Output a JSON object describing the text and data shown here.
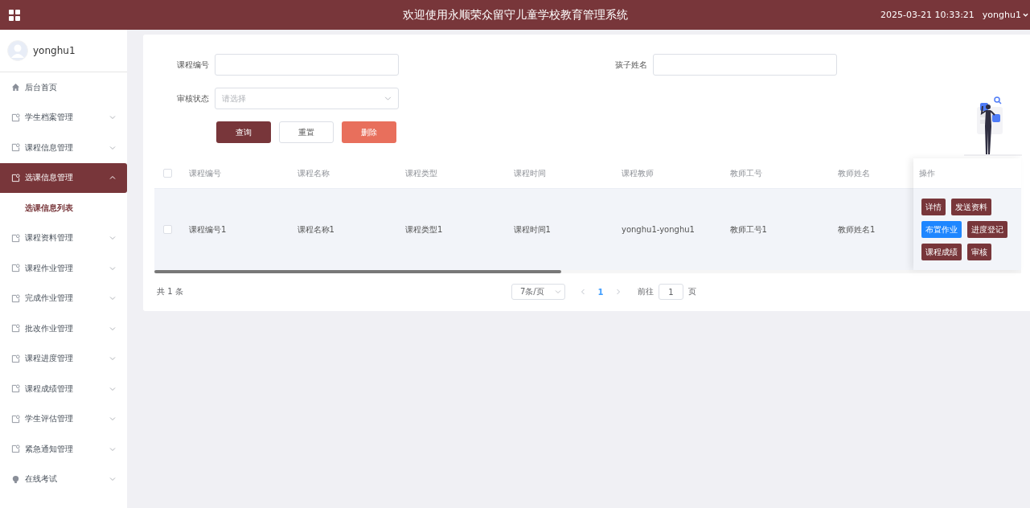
{
  "header": {
    "title": "欢迎使用永顺荣众留守儿童学校教育管理系统",
    "datetime": "2025-03-21 10:33:21",
    "user": "yonghu1"
  },
  "sidebar": {
    "user": "yonghu1",
    "items": [
      {
        "label": "后台首页",
        "kind": "home",
        "selected": false
      },
      {
        "label": "学生档案管理",
        "kind": "folder",
        "selected": false,
        "expanded": false
      },
      {
        "label": "课程信息管理",
        "kind": "folder",
        "selected": false,
        "expanded": false
      },
      {
        "label": "选课信息管理",
        "kind": "folder",
        "selected": true,
        "expanded": true,
        "children": [
          {
            "label": "选课信息列表",
            "selected": true
          }
        ]
      },
      {
        "label": "课程资料管理",
        "kind": "folder",
        "selected": false,
        "expanded": false
      },
      {
        "label": "课程作业管理",
        "kind": "folder",
        "selected": false,
        "expanded": false
      },
      {
        "label": "完成作业管理",
        "kind": "folder",
        "selected": false,
        "expanded": false
      },
      {
        "label": "批改作业管理",
        "kind": "folder",
        "selected": false,
        "expanded": false
      },
      {
        "label": "课程进度管理",
        "kind": "folder",
        "selected": false,
        "expanded": false
      },
      {
        "label": "课程成绩管理",
        "kind": "folder",
        "selected": false,
        "expanded": false
      },
      {
        "label": "学生评估管理",
        "kind": "folder",
        "selected": false,
        "expanded": false
      },
      {
        "label": "紧急通知管理",
        "kind": "folder",
        "selected": false,
        "expanded": false
      },
      {
        "label": "在线考试",
        "kind": "exam",
        "selected": false,
        "expanded": false
      }
    ]
  },
  "filters": [
    {
      "label": "课程编号",
      "kind": "input"
    },
    {
      "label": "孩子姓名",
      "kind": "input"
    },
    {
      "label": "审核状态",
      "kind": "select",
      "placeholder": "请选择"
    }
  ],
  "buttons": [
    {
      "label": "查询",
      "kind": "primary"
    },
    {
      "label": "重置",
      "kind": "plain"
    },
    {
      "label": "删除",
      "kind": "danger"
    }
  ],
  "table": {
    "select_all": false,
    "columns": [
      "课程编号",
      "课程名称",
      "课程类型",
      "课程时间",
      "课程教师",
      "教师工号",
      "教师姓名"
    ],
    "action_column": "操作",
    "rows": [
      {
        "checked": false,
        "cells": [
          "课程编号1",
          "课程名称1",
          "课程类型1",
          "课程时间1",
          "yonghu1-yonghu1",
          "教师工号1",
          "教师姓名1"
        ],
        "actions": [
          [
            {
              "label": "详情",
              "hovered": false
            },
            {
              "label": "发送资料",
              "hovered": false
            }
          ],
          [
            {
              "label": "布置作业",
              "hovered": true
            },
            {
              "label": "进度登记",
              "hovered": false
            }
          ],
          [
            {
              "label": "课程成绩",
              "hovered": false
            },
            {
              "label": "审核",
              "hovered": false
            }
          ]
        ]
      }
    ]
  },
  "pagination": {
    "total": "共 1 条",
    "page_size": "7条/页",
    "pages": [
      {
        "label": "1",
        "selected": true
      }
    ],
    "goto_label": "前往",
    "goto_value": "1",
    "goto_suffix": "页"
  }
}
